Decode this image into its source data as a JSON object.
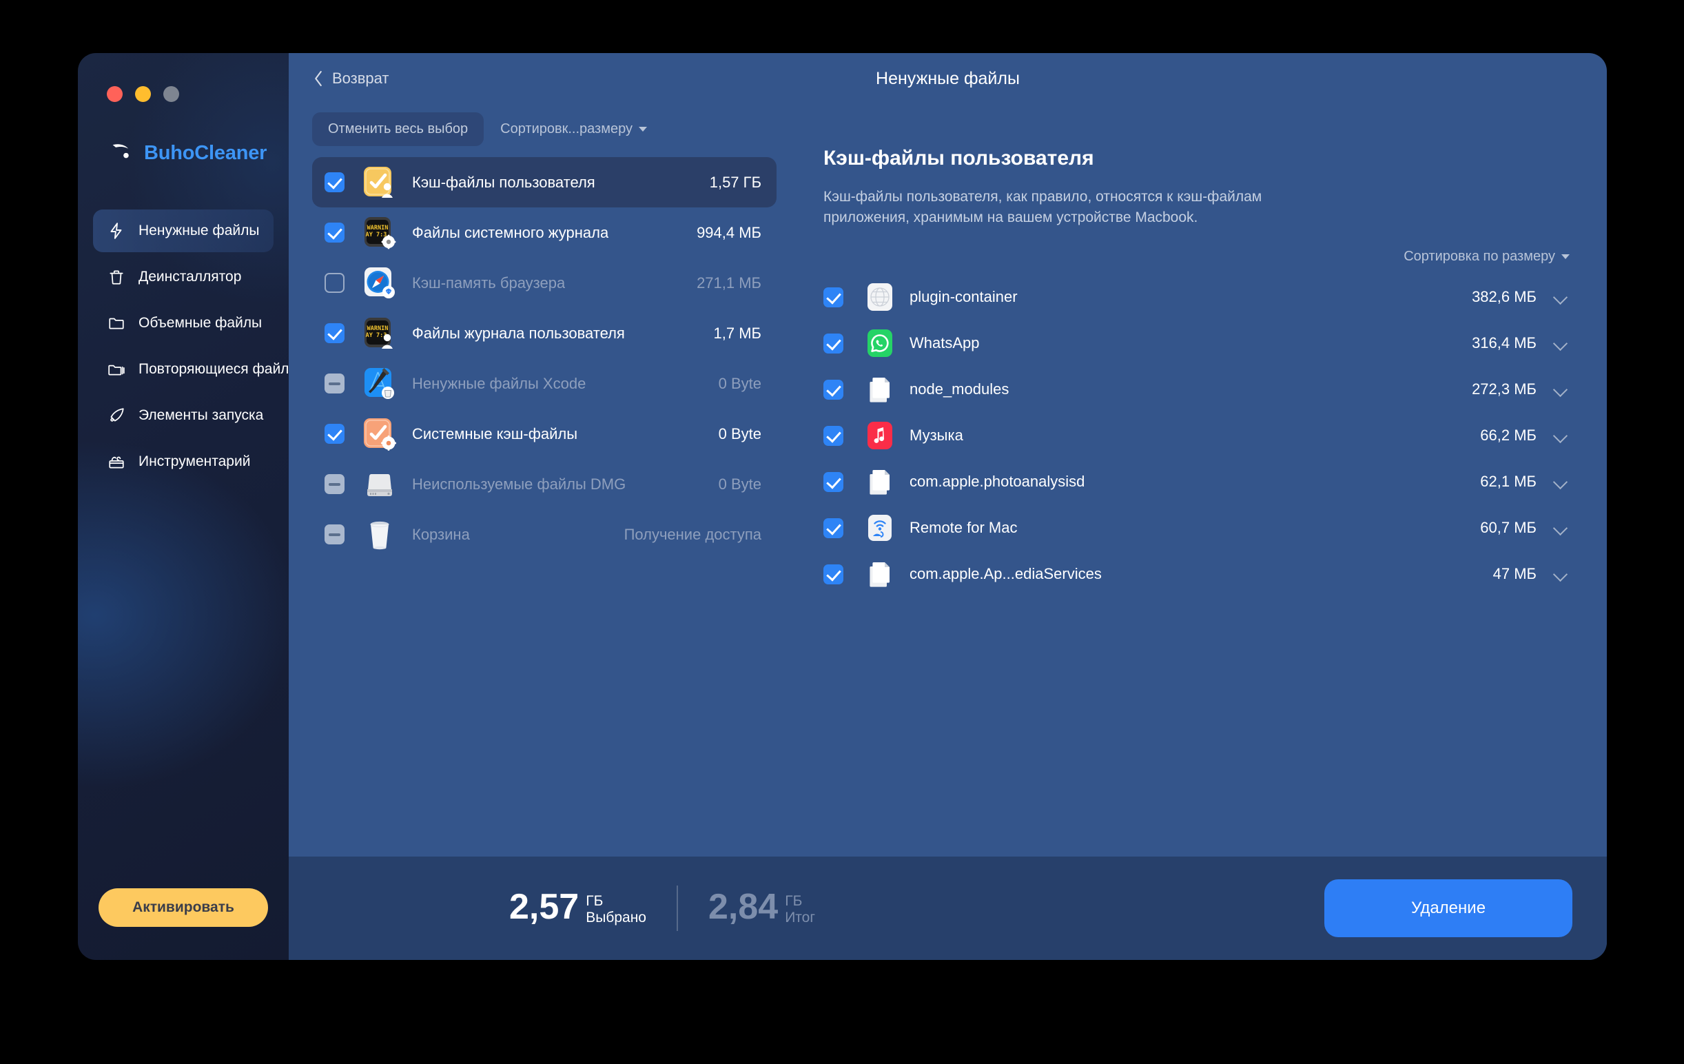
{
  "window": {
    "traffic_lights": [
      "close",
      "minimize",
      "maximize"
    ]
  },
  "brand": {
    "name": "BuhoCleaner",
    "logo_icon": "owl-logo-icon"
  },
  "sidebar": {
    "items": [
      {
        "label": "Ненужные файлы",
        "icon": "lightning-bolt-icon",
        "active": true
      },
      {
        "label": "Деинсталлятор",
        "icon": "trash-can-icon",
        "active": false
      },
      {
        "label": "Объемные файлы",
        "icon": "folder-icon",
        "active": false
      },
      {
        "label": "Повторяющиеся файлы",
        "icon": "folders-copy-icon",
        "active": false
      },
      {
        "label": "Элементы запуска",
        "icon": "rocket-icon",
        "active": false
      },
      {
        "label": "Инструментарий",
        "icon": "toolbox-icon",
        "active": false
      }
    ],
    "activate_label": "Активировать"
  },
  "header": {
    "back_label": "Возврат",
    "back_icon": "chevron-left-icon",
    "title": "Ненужные файлы"
  },
  "category_pane": {
    "deselect_all_label": "Отменить весь выбор",
    "sort_label": "Сортировк...размеру",
    "sort_caret_icon": "caret-down-icon",
    "rows": [
      {
        "name": "Кэш-файлы пользователя",
        "size": "1,57 ГБ",
        "checkbox": "checked",
        "selected": true,
        "dim": false,
        "icon": "user-cache-clock-icon",
        "link": false
      },
      {
        "name": "Файлы системного журнала",
        "size": "994,4 МБ",
        "checkbox": "checked",
        "selected": false,
        "dim": false,
        "icon": "system-log-warning-icon",
        "link": false
      },
      {
        "name": "Кэш-память браузера",
        "size": "271,1 МБ",
        "checkbox": "unchecked",
        "selected": false,
        "dim": true,
        "icon": "safari-browser-icon",
        "link": false
      },
      {
        "name": "Файлы журнала пользователя",
        "size": "1,7 МБ",
        "checkbox": "checked",
        "selected": false,
        "dim": false,
        "icon": "user-log-warning-icon",
        "link": false
      },
      {
        "name": "Ненужные файлы Xcode",
        "size": "0 Byte",
        "checkbox": "disabled",
        "selected": false,
        "dim": true,
        "icon": "xcode-hammer-icon",
        "link": false
      },
      {
        "name": "Системные кэш-файлы",
        "size": "0 Byte",
        "checkbox": "checked",
        "selected": false,
        "dim": false,
        "icon": "system-cache-gear-icon",
        "link": false
      },
      {
        "name": "Неиспользуемые файлы DMG",
        "size": "0 Byte",
        "checkbox": "disabled",
        "selected": false,
        "dim": true,
        "icon": "disk-drive-icon",
        "link": false
      },
      {
        "name": "Корзина",
        "size": "Получение доступа",
        "checkbox": "disabled",
        "selected": false,
        "dim": true,
        "icon": "trash-bin-icon",
        "link": true
      }
    ]
  },
  "detail_pane": {
    "title": "Кэш-файлы пользователя",
    "description": "Кэш-файлы пользователя, как правило, относятся к кэш-файлам приложения, хранимым на вашем устройстве Macbook.",
    "sort_label": "Сортировка по размеру",
    "sort_caret_icon": "caret-down-icon",
    "rows": [
      {
        "name": "plugin-container",
        "size": "382,6 МБ",
        "checkbox": "checked",
        "icon": "globe-app-icon",
        "expand_icon": "chevron-down-icon"
      },
      {
        "name": "WhatsApp",
        "size": "316,4 МБ",
        "checkbox": "checked",
        "icon": "whatsapp-icon",
        "expand_icon": "chevron-down-icon"
      },
      {
        "name": "node_modules",
        "size": "272,3 МБ",
        "checkbox": "checked",
        "icon": "document-copy-icon",
        "expand_icon": "chevron-down-icon"
      },
      {
        "name": "Музыка",
        "size": "66,2 МБ",
        "checkbox": "checked",
        "icon": "music-note-icon",
        "expand_icon": "chevron-down-icon"
      },
      {
        "name": "com.apple.photoanalysisd",
        "size": "62,1 МБ",
        "checkbox": "checked",
        "icon": "document-copy-icon",
        "expand_icon": "chevron-down-icon"
      },
      {
        "name": "Remote for Mac",
        "size": "60,7 МБ",
        "checkbox": "checked",
        "icon": "remote-wifi-icon",
        "expand_icon": "chevron-down-icon"
      },
      {
        "name": "com.apple.Ap...ediaServices",
        "size": "47 МБ",
        "checkbox": "checked",
        "icon": "document-copy-icon",
        "expand_icon": "chevron-down-icon"
      }
    ]
  },
  "bottom_bar": {
    "selected_value": "2,57",
    "selected_unit": "ГБ",
    "selected_label": "Выбрано",
    "total_value": "2,84",
    "total_unit": "ГБ",
    "total_label": "Итог",
    "delete_label": "Удаление"
  },
  "colors": {
    "accent_blue": "#2e7ef5",
    "brand_blue": "#3d95f5",
    "activate_yellow": "#fdc95f",
    "main_bg": "#34558b",
    "bottom_bg": "#27406b",
    "sidebar_bg": "#17203a",
    "row_selected": "#2b3f68",
    "link_blue": "#4a9bff"
  }
}
